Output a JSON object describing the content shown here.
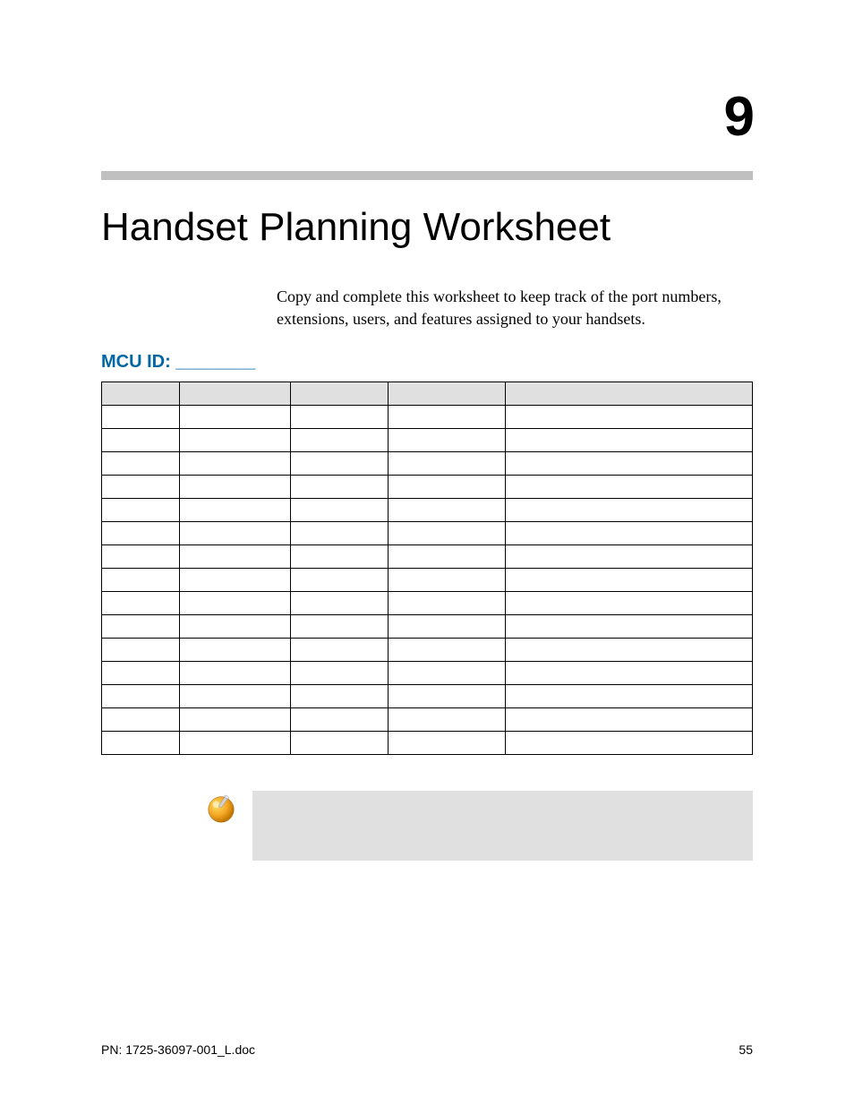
{
  "chapter_number": "9",
  "title": "Handset Planning Worksheet",
  "intro": "Copy and complete this worksheet to keep track of the port numbers, extensions, users, and features assigned to your handsets.",
  "mcu_label": "MCU ID: ________",
  "table": {
    "rows": 16,
    "cols": 5
  },
  "footer": {
    "pn": "PN: 1725-36097-001_L.doc",
    "page": "55"
  }
}
